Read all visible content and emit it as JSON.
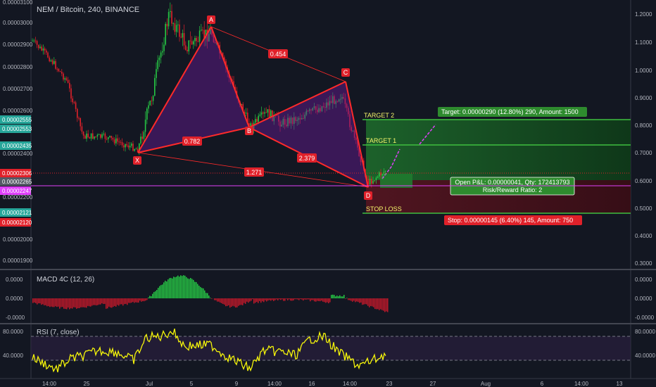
{
  "title": "NEM / Bitcoin, 240, BINANCE",
  "chart_data": {
    "type": "candlestick",
    "title": "NEM / Bitcoin, 240, BINANCE",
    "left_axis_ticks": [
      "0.00003100",
      "0.00003000",
      "0.00002900",
      "0.00002800",
      "0.00002700",
      "0.00002600",
      "0.00002400",
      "0.00002200",
      "0.00002000",
      "0.00001900"
    ],
    "left_axis_tags": [
      {
        "text": "0.00002555",
        "color": "#26a69a"
      },
      {
        "text": "0.00002553",
        "color": "#26a69a"
      },
      {
        "text": "0.00002435",
        "color": "#26a69a"
      },
      {
        "text": "0.00002306",
        "color": "#e0212a"
      },
      {
        "text": "0.00002265",
        "color": "#555a66"
      },
      {
        "text": "0.00002247",
        "color": "#e040fb"
      },
      {
        "text": "0.00002121",
        "color": "#26a69a"
      },
      {
        "text": "0.00002120",
        "color": "#e0212a"
      }
    ],
    "right_axis_ticks": [
      "1.2000",
      "1.1000",
      "1.0000",
      "0.9000",
      "0.8000",
      "0.7000",
      "0.6000",
      "0.5000",
      "0.4000",
      "0.3000"
    ],
    "time_axis": [
      "14:00",
      "25",
      "Jul",
      "5",
      "9",
      "14:00",
      "16",
      "14:00",
      "23",
      "27",
      "Aug",
      "6",
      "14:00",
      "13"
    ],
    "harmonic_points": [
      {
        "name": "X",
        "value": 2.4e-05
      },
      {
        "name": "A",
        "value": 2.985e-05
      },
      {
        "name": "B",
        "value": 2.545e-05
      },
      {
        "name": "C",
        "value": 2.73e-05
      },
      {
        "name": "D",
        "value": 2.247e-05
      }
    ],
    "ratios": [
      "0.454",
      "0.782",
      "2.379",
      "1.271"
    ],
    "targets": {
      "target2_label": "TARGET 2",
      "target1_label": "TARGET 1",
      "stop_label": "STOP LOSS",
      "target_box": "Target: 0.00000290 (12.80%) 290, Amount: 1500",
      "stop_box": "Stop: 0.00000145 (6.40%) 145, Amount: 750",
      "pnl_line1": "Open P&L: 0.00000041, Qty: 172413793",
      "pnl_line2": "Risk/Reward Ratio: 2"
    },
    "macd": {
      "label": "MACD 4C (12, 26)",
      "ticks": [
        "0.0000",
        "0.0000",
        "-0.0000"
      ],
      "right_ticks": [
        "0.0000",
        "0.0000",
        "-0.0000"
      ]
    },
    "rsi": {
      "label": "RSI (7, close)",
      "ticks": [
        "80.0000",
        "40.0000"
      ],
      "right_ticks": [
        "80.0000",
        "40.0000"
      ]
    }
  }
}
